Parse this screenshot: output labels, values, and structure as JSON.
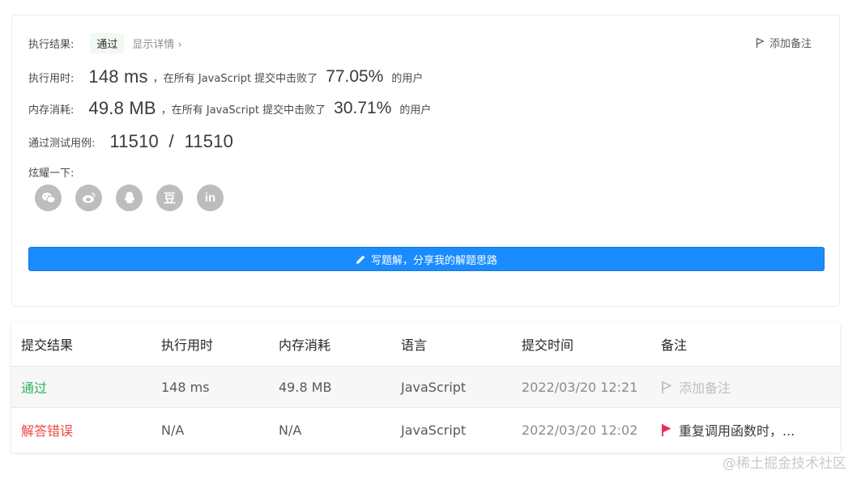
{
  "result": {
    "exec_label": "执行结果:",
    "status": "通过",
    "details_link": "显示详情 ›",
    "add_note": "添加备注",
    "runtime_label": "执行用时:",
    "runtime_value": "148 ms",
    "runtime_text": "，在所有 JavaScript 提交中击败了",
    "runtime_pct": "77.05%",
    "users_suffix": "的用户",
    "memory_label": "内存消耗:",
    "memory_value": "49.8 MB",
    "memory_text": "，在所有 JavaScript 提交中击败了",
    "memory_pct": "30.71%",
    "tests_label": "通过测试用例:",
    "tests_value": "11510  /  11510",
    "share_label": "炫耀一下:",
    "share_icons": [
      "wechat-icon",
      "weibo-icon",
      "qq-icon",
      "douban-icon",
      "linkedin-icon"
    ],
    "douban_glyph": "豆",
    "linkedin_glyph": "in",
    "write_button": "写题解，分享我的解题思路"
  },
  "table": {
    "headers": [
      "提交结果",
      "执行用时",
      "内存消耗",
      "语言",
      "提交时间",
      "备注"
    ],
    "rows": [
      {
        "result": "通过",
        "runtime": "148 ms",
        "memory": "49.8 MB",
        "language": "JavaScript",
        "time": "2022/03/20 12:21",
        "note": "添加备注"
      },
      {
        "result": "解答错误",
        "runtime": "N/A",
        "memory": "N/A",
        "language": "JavaScript",
        "time": "2022/03/20 12:02",
        "note": "重复调用函数时，..."
      }
    ]
  },
  "watermark": "@稀土掘金技术社区",
  "colors": {
    "accent": "#1a8cff",
    "pass": "#2db55d",
    "error": "#ef4743",
    "flag": "#f0265a"
  }
}
